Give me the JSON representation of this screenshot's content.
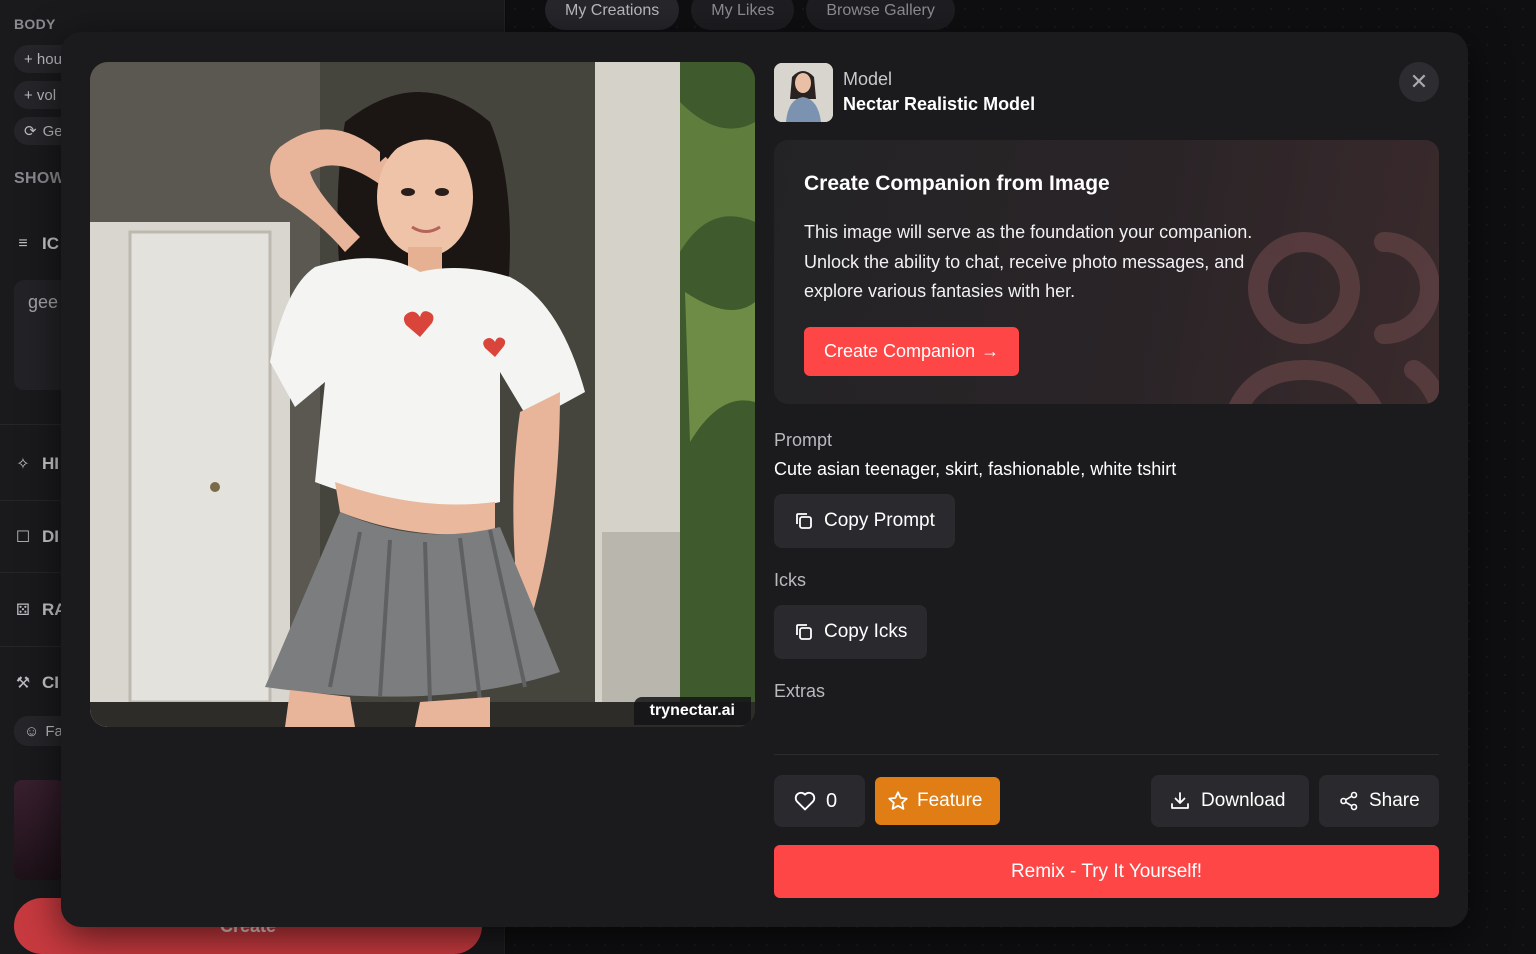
{
  "background": {
    "sidebar": {
      "body_label": "BODY",
      "chips": [
        "+ hou",
        "+ vol",
        "Ge"
      ],
      "show_label": "SHOW",
      "sections": [
        {
          "icon": "list-icon",
          "label": "IC"
        },
        {
          "icon": "sparkles-icon",
          "label": "HI"
        },
        {
          "icon": "square-icon",
          "label": "DI"
        },
        {
          "icon": "dice-icon",
          "label": "RA"
        },
        {
          "icon": "wrench-icon",
          "label": "CI"
        }
      ],
      "face_chip": "Fa",
      "textarea_value": "gee",
      "create_label": "Create"
    },
    "tabs": [
      "My Creations",
      "My Likes",
      "Browse Gallery"
    ],
    "active_tab": "My Creations"
  },
  "modal": {
    "image_watermark": "trynectar.ai",
    "model": {
      "label": "Model",
      "name": "Nectar Realistic Model"
    },
    "close_icon": "close-icon",
    "companion": {
      "title": "Create Companion from Image",
      "description": "This image will serve as the foundation your companion. Unlock the ability to chat, receive photo messages, and explore various fantasies with her.",
      "button_label": "Create Companion",
      "button_icon": "arrow-right-icon"
    },
    "prompt": {
      "label": "Prompt",
      "value": "Cute asian teenager, skirt, fashionable, white tshirt",
      "copy_label": "Copy Prompt"
    },
    "icks": {
      "label": "Icks",
      "copy_label": "Copy Icks"
    },
    "extras": {
      "label": "Extras"
    },
    "actions": {
      "like_count": "0",
      "feature_label": "Feature",
      "download_label": "Download",
      "share_label": "Share",
      "remix_label": "Remix - Try It Yourself!"
    }
  },
  "colors": {
    "accent_red": "#ff4646",
    "feature_orange": "#e07d14",
    "modal_bg": "#1b1b1e",
    "button_bg": "#2a2a2e"
  }
}
